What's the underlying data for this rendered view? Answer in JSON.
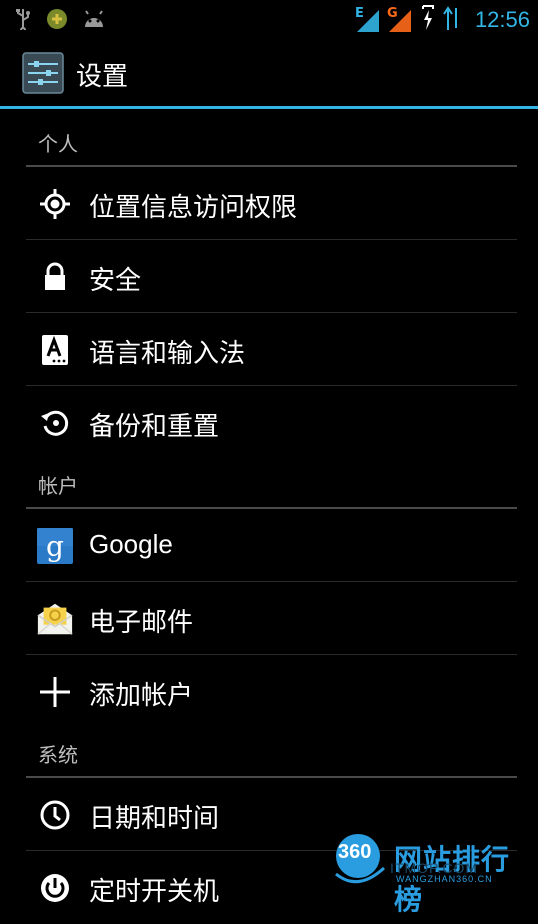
{
  "status_bar": {
    "time": "12:56",
    "net_e": "E",
    "net_g": "G",
    "icons": [
      "usb-icon",
      "game-icon",
      "android-icon",
      "signal-e-icon",
      "signal-g-icon",
      "battery-charging-icon",
      "data-transfer-icon"
    ]
  },
  "action_bar": {
    "title": "设置",
    "accent": "#33b5e5"
  },
  "sections": {
    "personal": {
      "header": "个人",
      "items": [
        {
          "label": "位置信息访问权限",
          "icon": "location-icon"
        },
        {
          "label": "安全",
          "icon": "lock-icon"
        },
        {
          "label": "语言和输入法",
          "icon": "language-icon"
        },
        {
          "label": "备份和重置",
          "icon": "restore-icon"
        }
      ]
    },
    "accounts": {
      "header": "帐户",
      "items": [
        {
          "label": "Google",
          "icon": "google-icon"
        },
        {
          "label": "电子邮件",
          "icon": "email-icon"
        },
        {
          "label": "添加帐户",
          "icon": "add-icon"
        }
      ]
    },
    "system": {
      "header": "系统",
      "items": [
        {
          "label": "日期和时间",
          "icon": "clock-icon"
        },
        {
          "label": "定时开关机",
          "icon": "power-icon"
        }
      ]
    }
  },
  "watermark": {
    "logo": "360",
    "text": "网站排行榜",
    "sub": "WANGZHAN360.CN",
    "faint": "ITMOP.COM"
  }
}
